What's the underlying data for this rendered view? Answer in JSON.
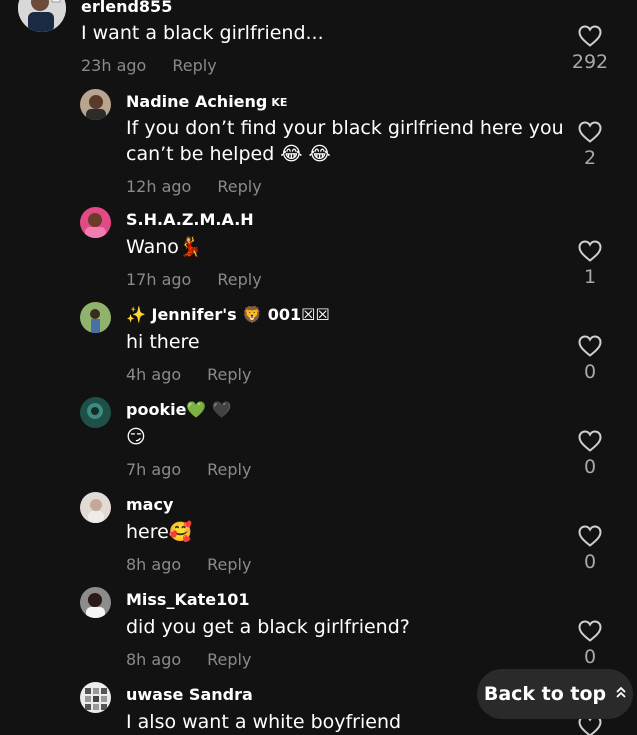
{
  "comments": [
    {
      "username": "erlend855",
      "badge": "",
      "text": "I want a black girlfriend...",
      "time": "23h ago",
      "reply_label": "Reply",
      "likes": "292",
      "avatar_color": "#cfcfcf"
    },
    {
      "username": "Nadine Achieng",
      "badge": "KE",
      "text_line1": "If you don’t find your black girlfriend here you",
      "text_line2": "can’t be helped 😂 😂",
      "time": "12h ago",
      "reply_label": "Reply",
      "likes": "2",
      "avatar_color": "#8a6a55"
    },
    {
      "username": "S.H.A.Z.M.A.H",
      "text": "Wano💃",
      "time": "17h ago",
      "reply_label": "Reply",
      "likes": "1",
      "avatar_color": "#d7457d"
    },
    {
      "username": "✨ Jennifer's 🦁 001☒☒",
      "text": "hi there",
      "time": "4h ago",
      "reply_label": "Reply",
      "likes": "0",
      "avatar_color": "#6f8f5a"
    },
    {
      "username": "pookie💚 🖤",
      "text": "😏",
      "time": "7h ago",
      "reply_label": "Reply",
      "likes": "0",
      "avatar_color": "#2e6a5e"
    },
    {
      "username": "macy",
      "text": "here🥰",
      "time": "8h ago",
      "reply_label": "Reply",
      "likes": "0",
      "avatar_color": "#d9cfc8"
    },
    {
      "username": "Miss_Kate101",
      "text": "did you get a black girlfriend?",
      "time": "8h ago",
      "reply_label": "Reply",
      "likes": "0",
      "avatar_color": "#4a3a32"
    },
    {
      "username": "uwase Sandra",
      "text": "I also want a white boyfriend",
      "avatar_color": "#e6e6e6"
    }
  ],
  "back_to_top": {
    "label": "Back to top",
    "icon": "chevrons-up-icon"
  },
  "colors": {
    "background": "#121212",
    "meta": "#8a8a8a",
    "like_count": "#a8a8a8",
    "heart_stroke": "#cfcfcf"
  }
}
